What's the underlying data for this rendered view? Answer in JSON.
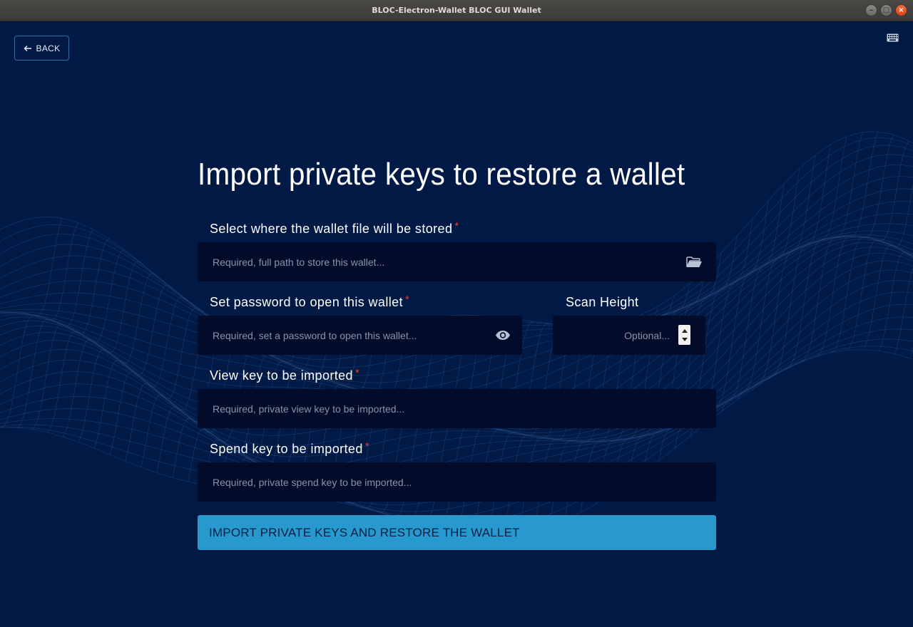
{
  "window": {
    "title": "BLOC-Electron-Wallet BLOC GUI Wallet"
  },
  "toolbar": {
    "back_label": "BACK"
  },
  "page": {
    "title": "Import private keys to restore a wallet"
  },
  "form": {
    "wallet_file": {
      "label": "Select where the wallet file will be stored",
      "required_mark": "*",
      "placeholder": "Required, full path to store this wallet...",
      "value": ""
    },
    "password": {
      "label": "Set password to open this wallet",
      "required_mark": "*",
      "placeholder": "Required, set a password to open this wallet...",
      "value": ""
    },
    "scan_height": {
      "label": "Scan Height",
      "placeholder": "Optional...",
      "value": ""
    },
    "view_key": {
      "label": "View key to be imported",
      "required_mark": "*",
      "placeholder": "Required, private view key to be imported...",
      "value": ""
    },
    "spend_key": {
      "label": "Spend key to be imported",
      "required_mark": "*",
      "placeholder": "Required, private spend key to be imported...",
      "value": ""
    },
    "submit_label": "IMPORT PRIVATE KEYS AND RESTORE THE WALLET"
  },
  "icons": {
    "back": "arrow-left-icon",
    "keyboard": "keyboard-icon",
    "folder": "folder-open-icon",
    "eye": "eye-icon"
  },
  "colors": {
    "background": "#011a45",
    "input_bg": "#020b29",
    "accent": "#2899cf",
    "required": "#e53935"
  }
}
